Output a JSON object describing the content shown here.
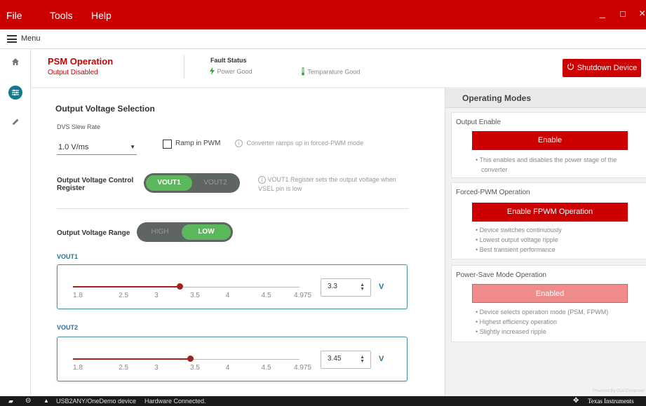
{
  "titlebar": {
    "menus": [
      "File",
      "Tools",
      "Help"
    ],
    "minimize": "_",
    "maximize": "□",
    "close": "×"
  },
  "menubar": {
    "label": "Menu"
  },
  "status": {
    "mode_title": "PSM Operation",
    "mode_sub": "Output Disabled",
    "fault_title": "Fault Status",
    "power_good": "Power Good",
    "temp_good": "Temparature Good",
    "shutdown_label": "Shutdown Device"
  },
  "main": {
    "section_title": "Output Voltage Selection",
    "dvs_label": "DVS Slew Rate",
    "dvs_value": "1.0 V/ms",
    "ramp_label": "Ramp in PWM",
    "ramp_info": "Converter ramps up in forced-PWM mode",
    "ctrl_reg_label_1": "Output Voltage Control",
    "ctrl_reg_label_2": "Register",
    "ctrl_opt1": "VOUT1",
    "ctrl_opt2": "VOUT2",
    "ctrl_info_1": "VOUT1 Register sets the output voltage when",
    "ctrl_info_2": "VSEL pin is low",
    "range_label": "Output Voltage Range",
    "range_opt1": "HIGH",
    "range_opt2": "LOW",
    "vout1": {
      "title": "VOUT1",
      "value": "3.3",
      "unit": "V",
      "ticks": [
        "1.8",
        "2.5",
        "3",
        "3.5",
        "4",
        "4.5",
        "4.975"
      ],
      "min": 1.8,
      "max": 4.975,
      "level": 3.3
    },
    "vout2": {
      "title": "VOUT2",
      "value": "3.45",
      "unit": "V",
      "ticks": [
        "1.8",
        "2.5",
        "3",
        "3.5",
        "4",
        "4.5",
        "4.975"
      ],
      "min": 1.8,
      "max": 4.975,
      "level": 3.45
    }
  },
  "right": {
    "header": "Operating Modes",
    "output_enable": {
      "title": "Output Enable",
      "button": "Enable",
      "bullets": [
        "This enables and disables the power stage of the converter"
      ]
    },
    "fpwm": {
      "title": "Forced-PWM Operation",
      "button": "Enable FPWM Operation",
      "bullets": [
        "Device switches continuously",
        "Lowest output voltage ripple",
        "Best transient performance"
      ]
    },
    "psm": {
      "title": "Power-Save Mode Operation",
      "button": "Enabled",
      "bullets": [
        "Device selects operation mode (PSM, FPWM)",
        "Highest efficiency operation",
        "Slightly increased ripple"
      ]
    },
    "powered_by": "Powered By GUI Composer"
  },
  "footer": {
    "connection": "USB2ANY/OneDemo device",
    "hw_status": "Hardware Connected.",
    "brand": "Texas Instruments"
  },
  "colors": {
    "brand_red": "#cc0000",
    "toggle_green": "#5cb85c",
    "slider_red": "#a32020",
    "accent_blue": "#2a6f9a"
  }
}
